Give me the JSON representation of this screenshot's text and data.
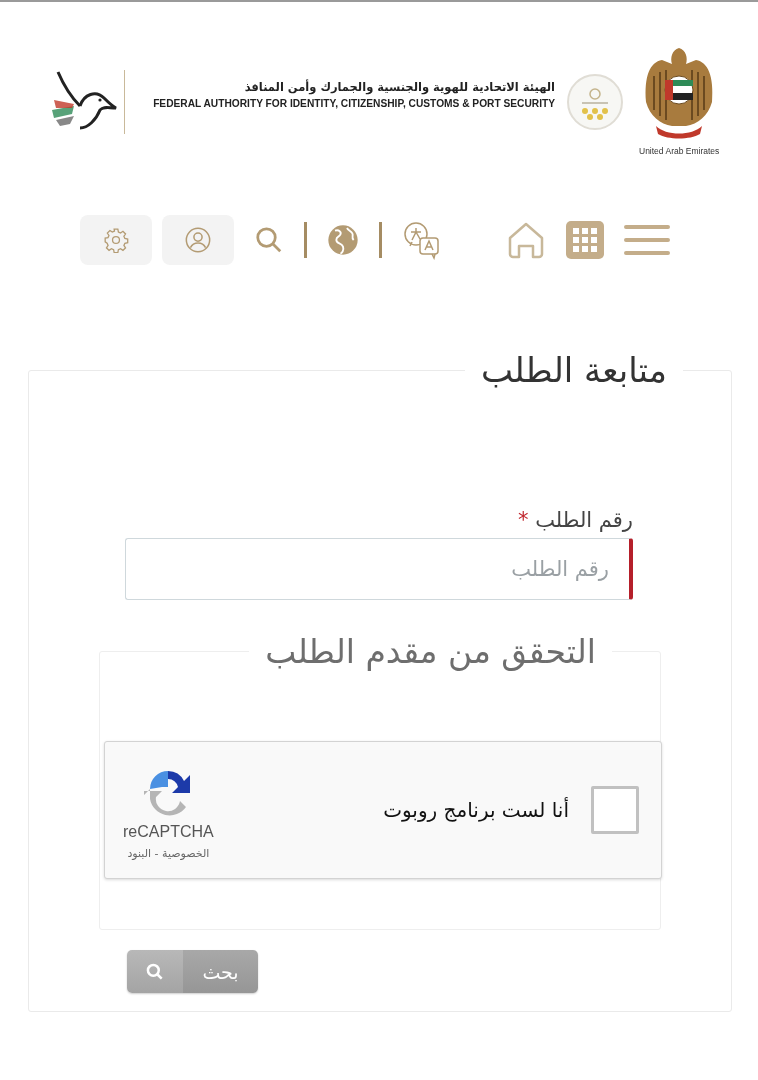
{
  "header": {
    "authority_name_ar": "الهيئة الاتحادية للهوية والجنسية والجمارك وأمن المنافذ",
    "authority_name_en": "FEDERAL AUTHORITY FOR IDENTITY, CITIZENSHIP, CUSTOMS & PORT SECURITY",
    "country": "United Arab Emirates"
  },
  "toolbar": [
    {
      "kind": "settings"
    },
    {
      "kind": "account"
    },
    {
      "kind": "search"
    },
    {
      "kind": "divider"
    },
    {
      "kind": "globe"
    },
    {
      "kind": "divider"
    },
    {
      "kind": "translate"
    },
    {
      "kind": "spacer"
    },
    {
      "kind": "home"
    },
    {
      "kind": "grid"
    },
    {
      "kind": "menu"
    }
  ],
  "form": {
    "title": "متابعة الطلب",
    "field": {
      "label": "رقم الطلب",
      "required_mark": "*",
      "placeholder": "رقم الطلب"
    },
    "verification": {
      "title": "التحقق من مقدم الطلب",
      "captcha": {
        "label": "أنا لست برنامج روبوت",
        "checked": false,
        "brand": "reCAPTCHA",
        "links": "الخصوصية - البنود"
      }
    },
    "submit": {
      "label": "بحث",
      "disabled": true
    }
  }
}
